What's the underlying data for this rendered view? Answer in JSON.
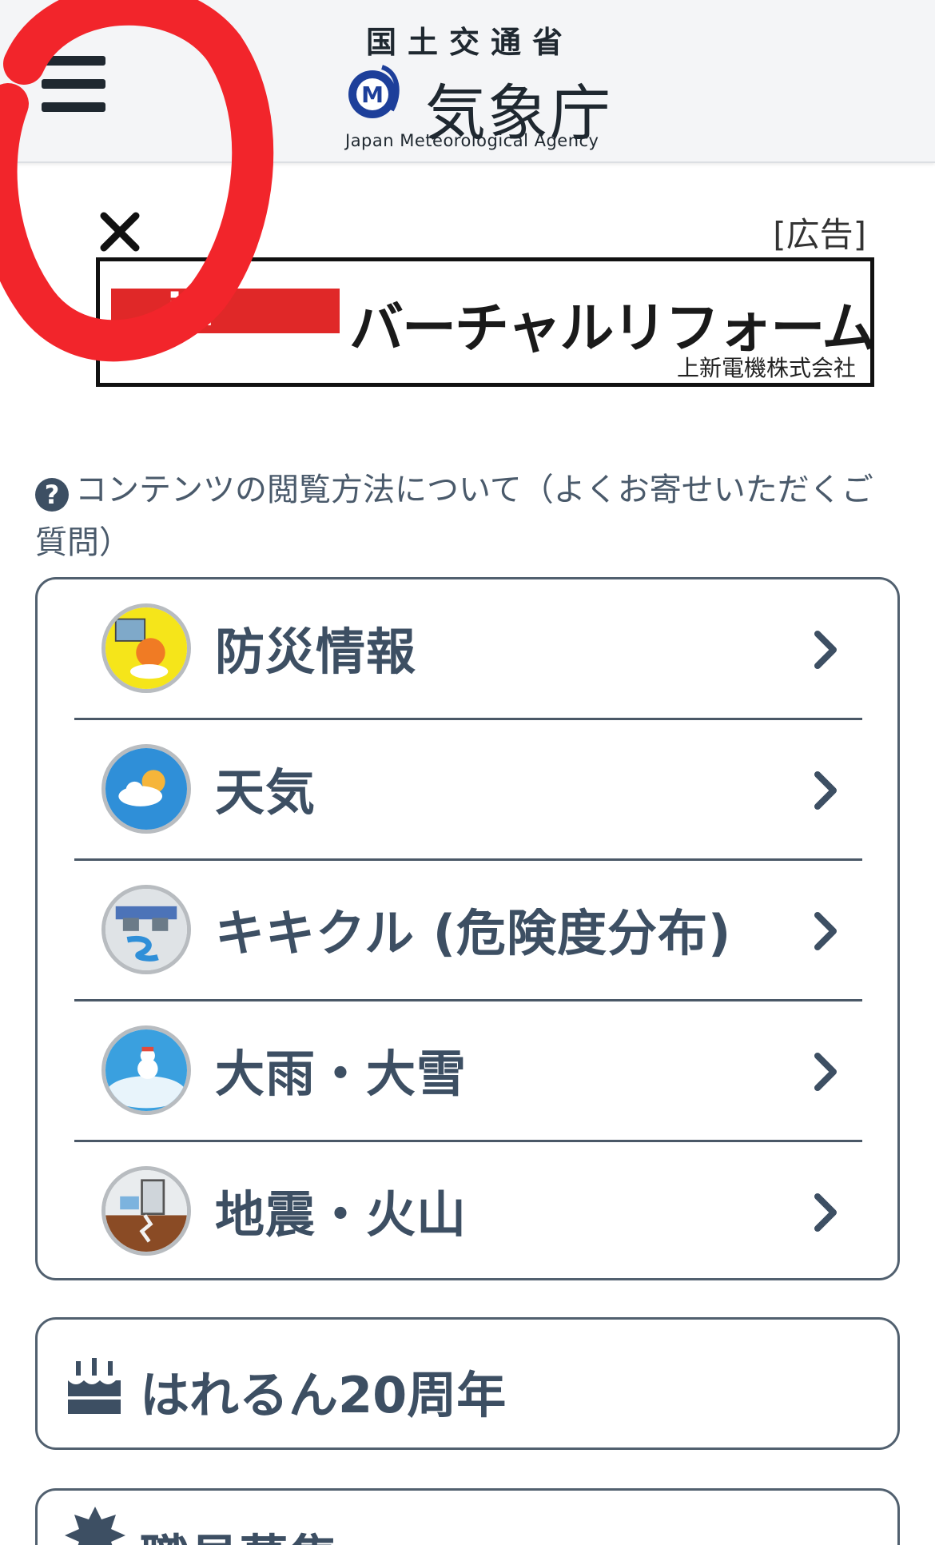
{
  "header": {
    "ministry": "国土交通省",
    "agency_name": "気象庁",
    "agency_en": "Japan Meteorological Agency",
    "menu_icon": "hamburger-menu-icon"
  },
  "ad": {
    "label": "[広告]",
    "close_icon": "close-icon",
    "brand_text": "in",
    "title": "バーチャルリフォーム店舗",
    "company": "上新電機株式会社"
  },
  "faq": {
    "icon": "question-circle-icon",
    "text": "コンテンツの閲覧方法について（よくお寄せいただくご質問）"
  },
  "menu": {
    "items": [
      {
        "label": "防災情報",
        "icon": "disaster-info-icon"
      },
      {
        "label": "天気",
        "icon": "weather-icon"
      },
      {
        "label": "キキクル (危険度分布)",
        "icon": "kikikuru-icon"
      },
      {
        "label": "大雨・大雪",
        "icon": "heavy-rain-snow-icon"
      },
      {
        "label": "地震・火山",
        "icon": "earthquake-volcano-icon"
      }
    ]
  },
  "anniversary": {
    "label": "はれるん20周年",
    "icon": "birthday-cake-icon"
  },
  "recruit": {
    "label": "職員募集",
    "icon": "recruit-badge-icon"
  },
  "colors": {
    "text": "#3d4f63",
    "border": "#51606f",
    "header_bg": "#f4f5f7",
    "annotation": "#f2252b",
    "ad_red": "#e02828"
  }
}
